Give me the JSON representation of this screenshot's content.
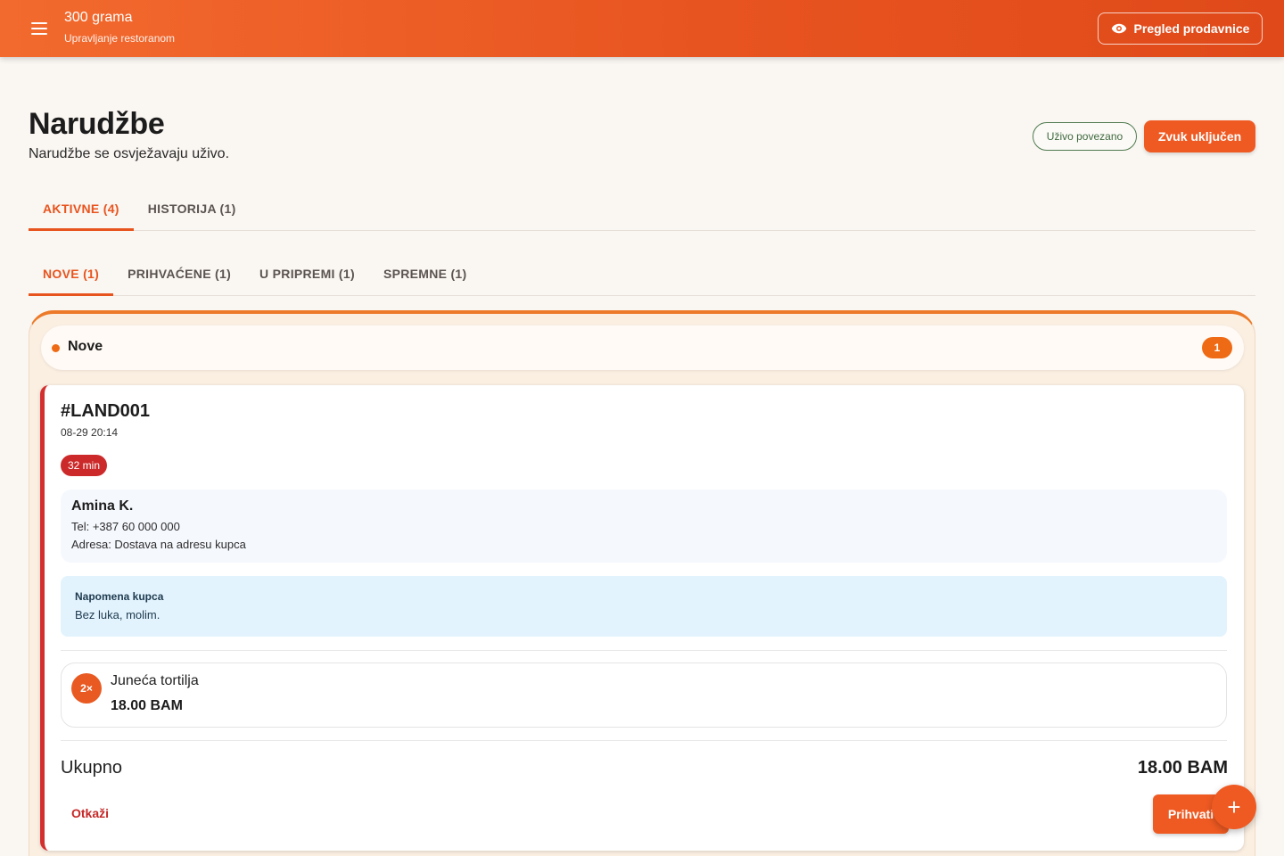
{
  "app": {
    "title": "300 grama",
    "subtitle": "Upravljanje restoranom",
    "preview_button": "Pregled prodavnice"
  },
  "header": {
    "title": "Narudžbe",
    "subtitle": "Narudžbe se osvježavaju uživo.",
    "live_status": "Uživo povezano",
    "sound_button": "Zvuk uključen"
  },
  "main_tabs": [
    {
      "label": "AKTIVNE (4)",
      "active": true
    },
    {
      "label": "HISTORIJA (1)",
      "active": false
    }
  ],
  "status_tabs": [
    {
      "label": "NOVE (1)",
      "active": true
    },
    {
      "label": "PRIHVAĆENE (1)",
      "active": false
    },
    {
      "label": "U PRIPREMI (1)",
      "active": false
    },
    {
      "label": "SPREMNE (1)",
      "active": false
    }
  ],
  "column": {
    "title": "Nove",
    "count": "1"
  },
  "order": {
    "id": "#LAND001",
    "time": "08-29 20:14",
    "elapsed": "32 min",
    "customer": {
      "name": "Amina K.",
      "phone": "Tel: +387 60 000 000",
      "address": "Adresa: Dostava na adresu kupca"
    },
    "note": {
      "label": "Napomena kupca",
      "text": "Bez luka, molim."
    },
    "items": [
      {
        "qty": "2×",
        "name": "Juneća tortilja",
        "price": "18.00 BAM"
      }
    ],
    "total_label": "Ukupno",
    "total_value": "18.00 BAM",
    "cancel_button": "Otkaži",
    "accept_button": "Prihvati"
  },
  "fab_label": "+",
  "colors": {
    "accent": "#ef5a22",
    "urgent": "#d32f2f",
    "live": "#3f6a3f"
  }
}
